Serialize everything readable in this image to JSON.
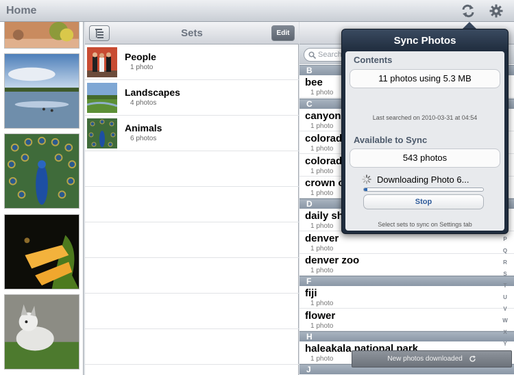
{
  "topbar": {
    "home_label": "Home",
    "icons": [
      "sync-icon",
      "gear-icon"
    ]
  },
  "sets_panel": {
    "title": "Sets",
    "edit_label": "Edit",
    "organize_icon": "list-organize-icon",
    "sets": [
      {
        "name": "People",
        "count": "1 photo"
      },
      {
        "name": "Landscapes",
        "count": "4 photos"
      },
      {
        "name": "Animals",
        "count": "6 photos"
      }
    ]
  },
  "photo_list": {
    "search_placeholder": "Search",
    "sections": [
      {
        "letter": "B",
        "items": [
          {
            "name": "bee",
            "count": "1 photo"
          }
        ]
      },
      {
        "letter": "C",
        "items": [
          {
            "name": "canyonl",
            "count": "1 photo"
          },
          {
            "name": "colorad",
            "count": "1 photo"
          },
          {
            "name": "colorad",
            "count": "1 photo"
          },
          {
            "name": "crown o",
            "count": "1 photo"
          }
        ]
      },
      {
        "letter": "D",
        "items": [
          {
            "name": "daily sh",
            "count": "1 photo"
          },
          {
            "name": "denver",
            "count": "1 photo"
          },
          {
            "name": "denver zoo",
            "count": "1 photo"
          }
        ]
      },
      {
        "letter": "F",
        "items": [
          {
            "name": "fiji",
            "count": "1 photo"
          },
          {
            "name": "flower",
            "count": "1 photo"
          }
        ]
      },
      {
        "letter": "H",
        "items": [
          {
            "name": "haleakala national park",
            "count": "1 photo"
          }
        ]
      },
      {
        "letter": "J",
        "items": []
      }
    ],
    "index_letters": [
      "P",
      "Q",
      "R",
      "S",
      "T",
      "U",
      "V",
      "W",
      "X",
      "Y",
      "Z"
    ]
  },
  "sync_popover": {
    "title": "Sync Photos",
    "contents_heading": "Contents",
    "contents_value": "11 photos using 5.3 MB",
    "last_searched": "Last searched on 2010-03-31 at 04:54",
    "available_heading": "Available to Sync",
    "available_value": "543 photos",
    "downloading_text": "Downloading Photo 6...",
    "progress_fraction": 0.03,
    "stop_label": "Stop",
    "footer_note": "Select sets to sync on Settings tab"
  },
  "toast": {
    "text": "New photos downloaded"
  },
  "colors": {
    "accent_blue": "#2f69b2",
    "section_header": "#8a97a6",
    "popover_dark": "#1f2c3d"
  }
}
